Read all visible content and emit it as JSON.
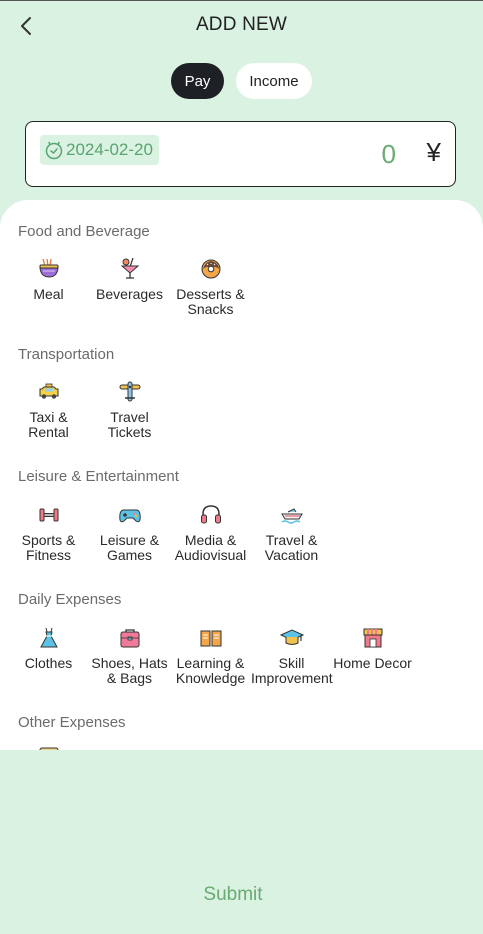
{
  "header": {
    "title": "ADD NEW",
    "back_icon": "chevron-left-icon"
  },
  "type_toggle": {
    "pay_label": "Pay",
    "income_label": "Income",
    "selected": "Pay"
  },
  "entry": {
    "date": "2024-02-20",
    "amount": "0",
    "currency": "¥"
  },
  "sections": [
    {
      "title": "Food and Beverage",
      "items": [
        {
          "label": "Meal",
          "icon": "noodle-bowl-icon"
        },
        {
          "label": "Beverages",
          "icon": "cocktail-icon"
        },
        {
          "label": "Desserts & Snacks",
          "icon": "donut-icon"
        }
      ]
    },
    {
      "title": "Transportation",
      "items": [
        {
          "label": "Taxi & Rental",
          "icon": "taxi-icon"
        },
        {
          "label": "Travel Tickets",
          "icon": "airplane-icon"
        }
      ]
    },
    {
      "title": "Leisure & Entertainment",
      "items": [
        {
          "label": "Sports & Fitness",
          "icon": "dumbbell-icon"
        },
        {
          "label": "Leisure & Games",
          "icon": "gamepad-icon"
        },
        {
          "label": "Media & Audiovisual",
          "icon": "headphones-icon"
        },
        {
          "label": "Travel & Vacation",
          "icon": "speedboat-icon"
        }
      ]
    },
    {
      "title": "Daily Expenses",
      "items": [
        {
          "label": "Clothes",
          "icon": "dress-icon"
        },
        {
          "label": "Shoes, Hats & Bags",
          "icon": "bag-icon"
        },
        {
          "label": "Learning & Knowledge",
          "icon": "book-icon"
        },
        {
          "label": "Skill Improvement",
          "icon": "graduation-cap-icon"
        },
        {
          "label": "Home Decor",
          "icon": "storefront-icon"
        }
      ]
    },
    {
      "title": "Other Expenses",
      "items": []
    }
  ],
  "submit_label": "Submit",
  "colors": {
    "background": "#d9f2e2",
    "accent": "#6aaa73",
    "dark": "#1d2024"
  }
}
